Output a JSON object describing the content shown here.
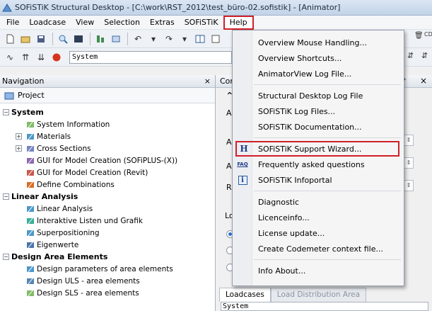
{
  "window": {
    "title": "SOFiSTiK Structural Desktop - [C:\\work\\RST_2012\\test_büro-02.sofistik] - [Animator]"
  },
  "menubar": [
    "File",
    "Loadcase",
    "View",
    "Selection",
    "Extras",
    "SOFiSTiK",
    "Help"
  ],
  "toolbar2": {
    "combo_value": "System"
  },
  "navigation": {
    "title": "Navigation",
    "close": "×",
    "project": "Project",
    "tree": [
      {
        "label": "System",
        "group": true,
        "indent": 0
      },
      {
        "label": "System Information",
        "indent": 1
      },
      {
        "label": "Materials",
        "indent": 1,
        "expander": "+"
      },
      {
        "label": "Cross Sections",
        "indent": 1,
        "expander": "+"
      },
      {
        "label": "GUI for Model Creation (SOFiPLUS-(X))",
        "indent": 1
      },
      {
        "label": "GUI for Model Creation (Revit)",
        "indent": 1
      },
      {
        "label": "Define Combinations",
        "indent": 1
      },
      {
        "label": "Linear Analysis",
        "group": true,
        "indent": 0
      },
      {
        "label": "Linear Analysis",
        "indent": 1
      },
      {
        "label": "Interaktive Listen und Grafik",
        "indent": 1
      },
      {
        "label": "Superpositioning",
        "indent": 1
      },
      {
        "label": "Eigenwerte",
        "indent": 1
      },
      {
        "label": "Design Area Elements",
        "group": true,
        "indent": 0
      },
      {
        "label": "Design parameters of area elements",
        "indent": 1
      },
      {
        "label": "Design ULS - area elements",
        "indent": 1
      },
      {
        "label": "Design SLS - area elements",
        "indent": 1
      }
    ]
  },
  "content": {
    "title": "Con",
    "pin": "ₐ",
    "close": "×",
    "letters": [
      "A",
      "A",
      "A",
      "R",
      "Lo"
    ],
    "tabs": [
      "Loadcases",
      "Load Distribution Area"
    ],
    "system_field": "System"
  },
  "help_menu": {
    "items": [
      {
        "label": "Overview Mouse Handling...",
        "icon": ""
      },
      {
        "label": "Overview Shortcuts...",
        "icon": ""
      },
      {
        "label": "AnimatorView Log File...",
        "icon": ""
      },
      {
        "sep": true
      },
      {
        "label": "Structural Desktop Log File",
        "icon": ""
      },
      {
        "label": "SOFiSTiK Log Files...",
        "icon": ""
      },
      {
        "label": "SOFiSTiK Documentation...",
        "icon": ""
      },
      {
        "sep": true
      },
      {
        "label": "SOFiSTiK Support Wizard...",
        "icon": "H",
        "highlight": true
      },
      {
        "label": "Frequently asked questions",
        "icon": "FAQ"
      },
      {
        "label": "SOFiSTiK Infoportal",
        "icon": "i"
      },
      {
        "sep": true
      },
      {
        "label": "Diagnostic",
        "icon": ""
      },
      {
        "label": "Licenceinfo...",
        "icon": ""
      },
      {
        "label": "License update...",
        "icon": ""
      },
      {
        "label": "Create Codemeter context file...",
        "icon": ""
      },
      {
        "sep": true
      },
      {
        "label": "Info About...",
        "icon": ""
      }
    ]
  },
  "colors": {
    "highlight_border": "#d0202a",
    "accent": "#2f6fd6"
  }
}
